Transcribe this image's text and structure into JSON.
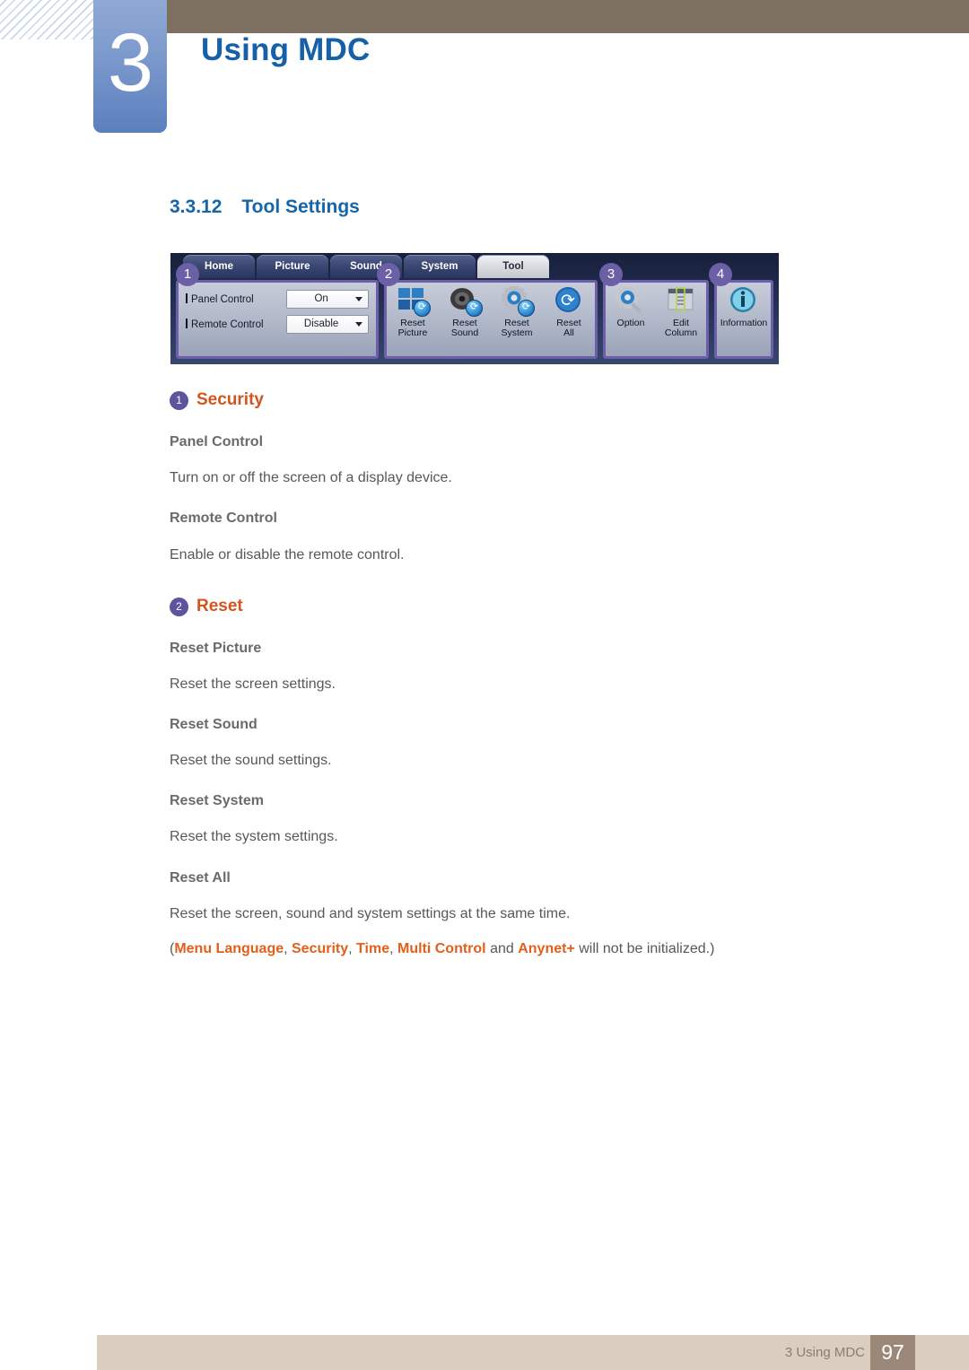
{
  "header": {
    "chapter_number": "3",
    "chapter_title": "Using MDC"
  },
  "section": {
    "number": "3.3.12",
    "title": "Tool Settings"
  },
  "figure": {
    "tabs": [
      {
        "label": "Home",
        "active": false
      },
      {
        "label": "Picture",
        "active": false
      },
      {
        "label": "Sound",
        "active": false
      },
      {
        "label": "System",
        "active": false
      },
      {
        "label": "Tool",
        "active": true
      }
    ],
    "badges": [
      "1",
      "2",
      "3",
      "4"
    ],
    "panel1": {
      "rows": [
        {
          "label": "Panel Control",
          "value": "On"
        },
        {
          "label": "Remote Control",
          "value": "Disable"
        }
      ]
    },
    "panel2": {
      "buttons": [
        {
          "label": "Reset\nPicture",
          "icon": "reset-picture-icon"
        },
        {
          "label": "Reset\nSound",
          "icon": "reset-sound-icon"
        },
        {
          "label": "Reset\nSystem",
          "icon": "reset-system-icon"
        },
        {
          "label": "Reset\nAll",
          "icon": "reset-all-icon"
        }
      ]
    },
    "panel3": {
      "buttons": [
        {
          "label": "Option",
          "icon": "option-gear-icon"
        },
        {
          "label": "Edit\nColumn",
          "icon": "edit-column-icon"
        }
      ]
    },
    "panel4": {
      "buttons": [
        {
          "label": "Information",
          "icon": "information-icon"
        }
      ]
    }
  },
  "content": {
    "security": {
      "badge": "1",
      "title": "Security",
      "items": [
        {
          "head": "Panel Control",
          "text": "Turn on or off the screen of a display device."
        },
        {
          "head": "Remote Control",
          "text": "Enable or disable the remote control."
        }
      ]
    },
    "reset": {
      "badge": "2",
      "title": "Reset",
      "items": [
        {
          "head": "Reset Picture",
          "text": "Reset the screen settings."
        },
        {
          "head": "Reset Sound",
          "text": "Reset the sound settings."
        },
        {
          "head": "Reset System",
          "text": "Reset the system settings."
        },
        {
          "head": "Reset All",
          "text": "Reset the screen, sound and system settings at the same time."
        }
      ],
      "note": {
        "open": "(",
        "t1": "Menu Language",
        "sep1": ", ",
        "t2": "Security",
        "sep2": ", ",
        "t3": "Time",
        "sep3": ", ",
        "t4": "Multi Control",
        "sep4": " and ",
        "t5": "Anynet+",
        "tail": " will not be initialized.)"
      }
    }
  },
  "footer": {
    "label": "3 Using MDC",
    "page": "97"
  },
  "colors": {
    "chapter_blue": "#1560a8",
    "header_brown": "#7d7060",
    "accent_orange": "#d4541e",
    "badge_purple": "#5d54a0",
    "footer_tan": "#d9cec0",
    "page_box": "#9c8878"
  }
}
